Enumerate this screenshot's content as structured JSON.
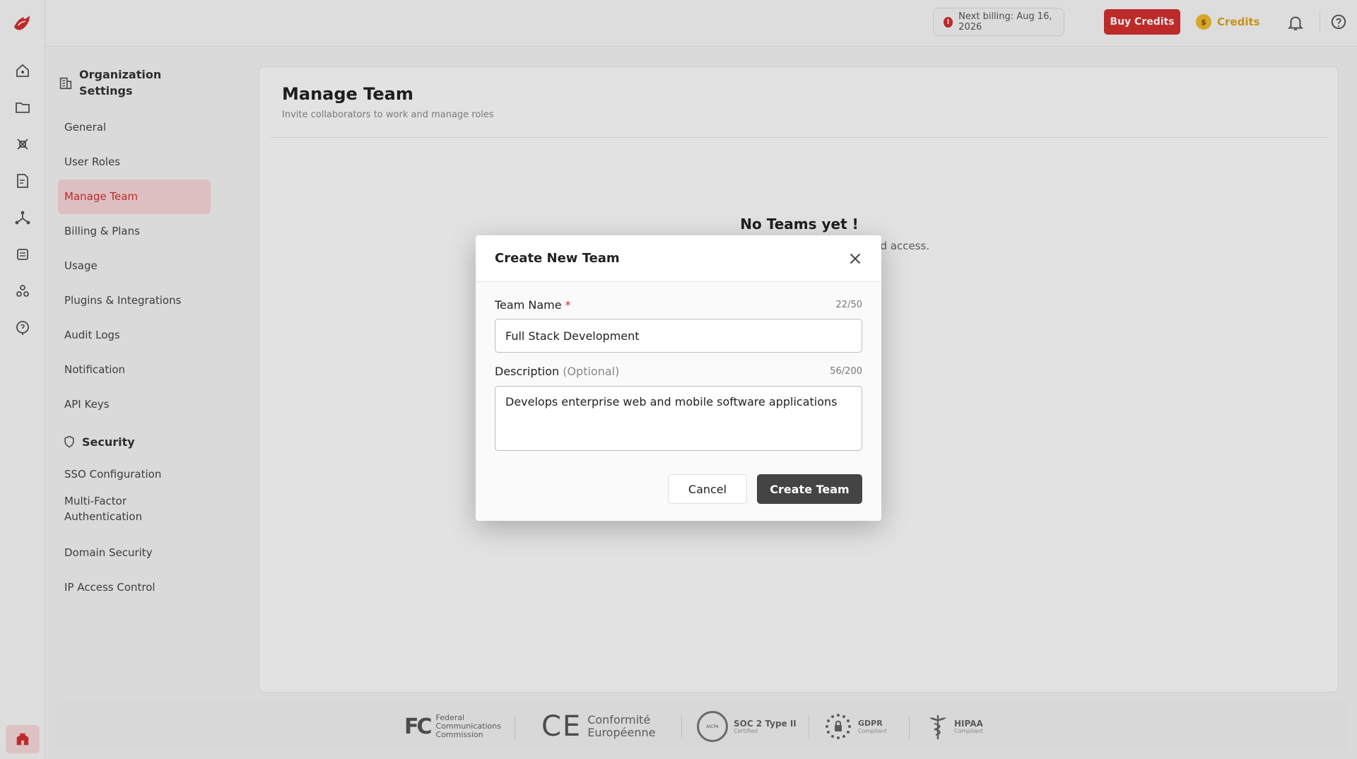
{
  "topbar": {
    "billing_text": "Next billing: Aug 16, 2026",
    "billing_alert_glyph": "!",
    "buy_credits_label": "Buy Credits",
    "credits_label": "Credits",
    "coin_glyph": "$",
    "icons": [
      "bell-icon",
      "help-icon"
    ]
  },
  "rail": {
    "icons": [
      "home-icon",
      "folder-icon",
      "workflow-icon",
      "document-icon",
      "network-icon",
      "table-icon",
      "shapes-icon",
      "support-icon",
      "organization-icon"
    ]
  },
  "settings_nav": {
    "heading": "Organization Settings",
    "items": [
      "General",
      "User Roles",
      "Manage Team",
      "Billing & Plans",
      "Usage",
      "Plugins & Integrations",
      "Audit Logs",
      "Notification",
      "API Keys"
    ],
    "active_item": "Manage Team",
    "security_heading": "Security",
    "security_items": [
      "SSO Configuration",
      "Multi-Factor Authentication",
      "Domain Security",
      "IP Access Control"
    ]
  },
  "main": {
    "title": "Manage Team",
    "subtitle": "Invite collaborators to work and manage roles",
    "empty_title": "No Teams yet !",
    "empty_subtitle_visible": "and access."
  },
  "footer": {
    "badges": [
      {
        "mark": "FC",
        "label": "Federal Communications Commission"
      },
      {
        "mark": "CE",
        "label": "Conformité Européenne"
      },
      {
        "mark": "AICPA",
        "label": "SOC 2 Type II",
        "sub": "Certified"
      },
      {
        "mark": "GDPR",
        "label": "GDPR",
        "sub": "Compliant"
      },
      {
        "mark": "HIPAA",
        "label": "HIPAA",
        "sub": "Compliant"
      }
    ]
  },
  "modal": {
    "title": "Create New Team",
    "team_name_label": "Team Name",
    "required_mark": "*",
    "team_name_value": "Full Stack Development",
    "team_name_counter": "22/50",
    "description_label": "Description",
    "description_optional": "(Optional)",
    "description_value": "Develops enterprise web and mobile software applications",
    "description_counter": "56/200",
    "cancel_label": "Cancel",
    "create_label": "Create Team"
  },
  "colors": {
    "brand_red": "#d32f2f",
    "active_bg": "#f6d5d8",
    "credits_gold": "#e0a21b",
    "primary_dark": "#444444"
  }
}
